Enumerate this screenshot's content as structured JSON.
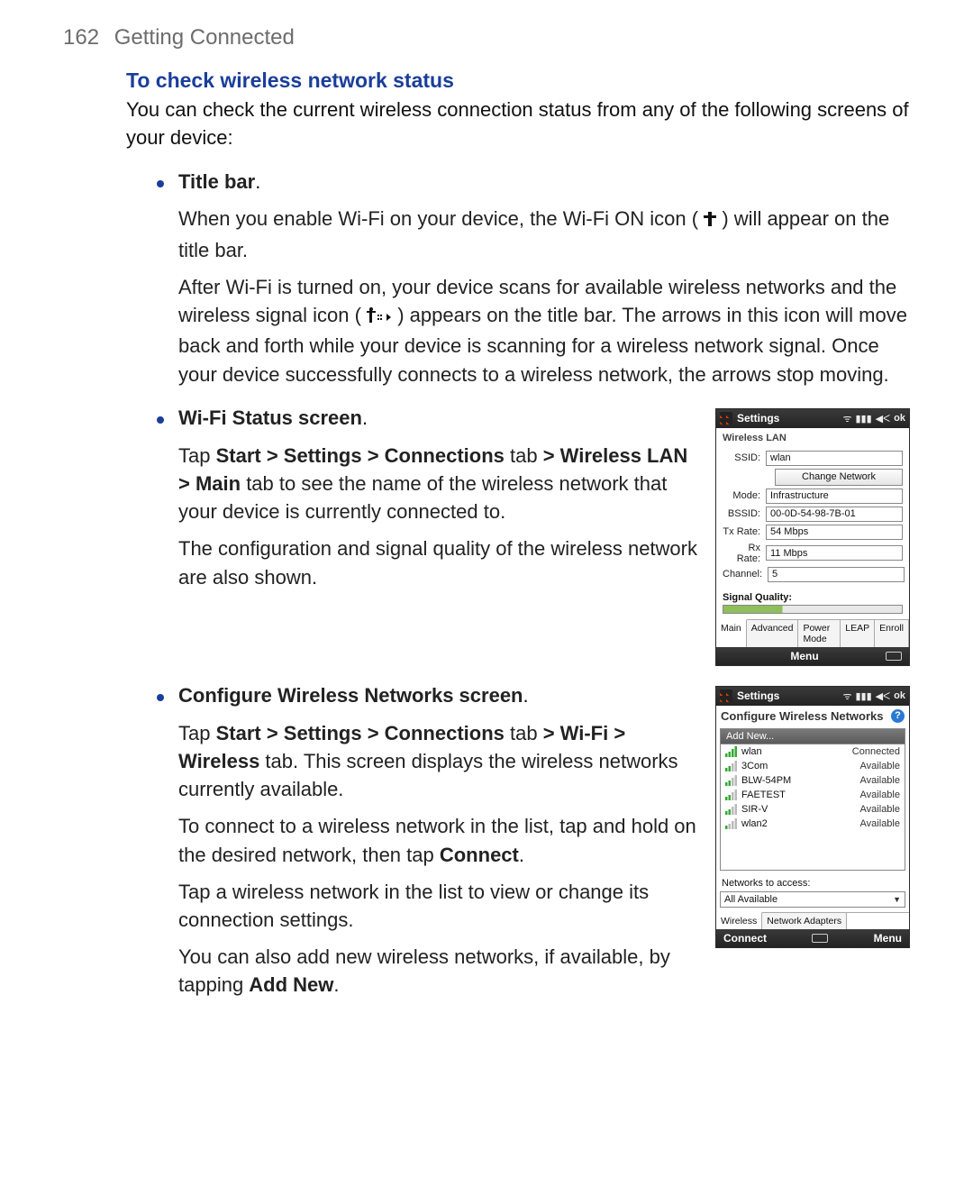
{
  "header": {
    "page_number": "162",
    "chapter": "Getting Connected"
  },
  "section": {
    "heading": "To check wireless network status",
    "intro": "You can check the current wireless connection status from any of the following screens of your device:"
  },
  "bullets": {
    "b1": {
      "title": "Title bar",
      "dot_after_title": ".",
      "p1a": "When you enable Wi-Fi on your device, the Wi-Fi ON icon (",
      "p1b": ") will appear on the title bar.",
      "p2a": "After Wi-Fi is turned on, your device scans for available wireless networks and the wireless signal icon (",
      "p2b": ") appears on the title bar. The arrows in this icon will move back and forth while your device is scanning for a wireless network signal. Once your device successfully connects to a wireless network, the arrows stop moving."
    },
    "b2": {
      "title": "Wi-Fi Status screen",
      "dot_after_title": ".",
      "p1_pre": "Tap ",
      "p1_bold": "Start > Settings > Connections",
      "p1_mid": " tab ",
      "p1_bold2": "> Wireless LAN > Main",
      "p1_post": " tab to see the name of the wireless network that your device is currently connected to.",
      "p2": "The configuration and signal quality of the wireless network are also shown."
    },
    "b3": {
      "title": "Configure Wireless Networks screen",
      "dot_after_title": ".",
      "p1_pre": "Tap ",
      "p1_bold": "Start > Settings > Connections",
      "p1_mid": " tab ",
      "p1_bold2": "> Wi-Fi > Wireless",
      "p1_post": " tab. This screen displays the wireless networks currently available.",
      "p2_pre": "To connect to a wireless network in the list, tap and hold on the desired network, then tap ",
      "p2_bold": "Connect",
      "p2_post": ".",
      "p3": "Tap a wireless network in the list to view or change its connection settings.",
      "p4_pre": "You can also add new wireless networks, if available, by tapping ",
      "p4_bold": "Add New",
      "p4_post": "."
    }
  },
  "device1": {
    "title": "Settings",
    "ok": "ok",
    "panel": "Wireless LAN",
    "rows": {
      "ssid_l": "SSID:",
      "ssid_v": "wlan",
      "btn": "Change Network",
      "mode_l": "Mode:",
      "mode_v": "Infrastructure",
      "bssid_l": "BSSID:",
      "bssid_v": "00-0D-54-98-7B-01",
      "tx_l": "Tx Rate:",
      "tx_v": "54 Mbps",
      "rx_l": "Rx Rate:",
      "rx_v": "11 Mbps",
      "ch_l": "Channel:",
      "ch_v": "5"
    },
    "sig_label": "Signal Quality:",
    "tabs": [
      "Main",
      "Advanced",
      "Power Mode",
      "LEAP",
      "Enroll"
    ],
    "soft_left": "",
    "soft_right": "Menu"
  },
  "device2": {
    "title": "Settings",
    "ok": "ok",
    "heading": "Configure Wireless Networks",
    "add_new": "Add New...",
    "networks": [
      {
        "name": "wlan",
        "status": "Connected",
        "strength": "high"
      },
      {
        "name": "3Com",
        "status": "Available",
        "strength": "med"
      },
      {
        "name": "BLW-54PM",
        "status": "Available",
        "strength": "med"
      },
      {
        "name": "FAETEST",
        "status": "Available",
        "strength": "med"
      },
      {
        "name": "SIR-V",
        "status": "Available",
        "strength": "med"
      },
      {
        "name": "wlan2",
        "status": "Available",
        "strength": "low"
      }
    ],
    "access_label": "Networks to access:",
    "combo_value": "All Available",
    "tabs": [
      "Wireless",
      "Network Adapters"
    ],
    "soft_left": "Connect",
    "soft_right": "Menu"
  }
}
